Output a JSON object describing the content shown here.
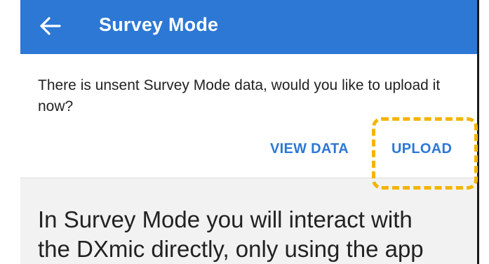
{
  "app_bar": {
    "title": "Survey Mode",
    "back_icon": "arrow-left-icon",
    "color": "#2c78d4"
  },
  "dialog": {
    "message": "There is unsent Survey Mode data, would you like to upload it now?",
    "view_data_label": "VIEW DATA",
    "upload_label": "UPLOAD",
    "highlight_color": "#f4b400"
  },
  "content": {
    "line1": "In Survey Mode you will interact with",
    "line2": "the DXmic directly, only using the app"
  }
}
